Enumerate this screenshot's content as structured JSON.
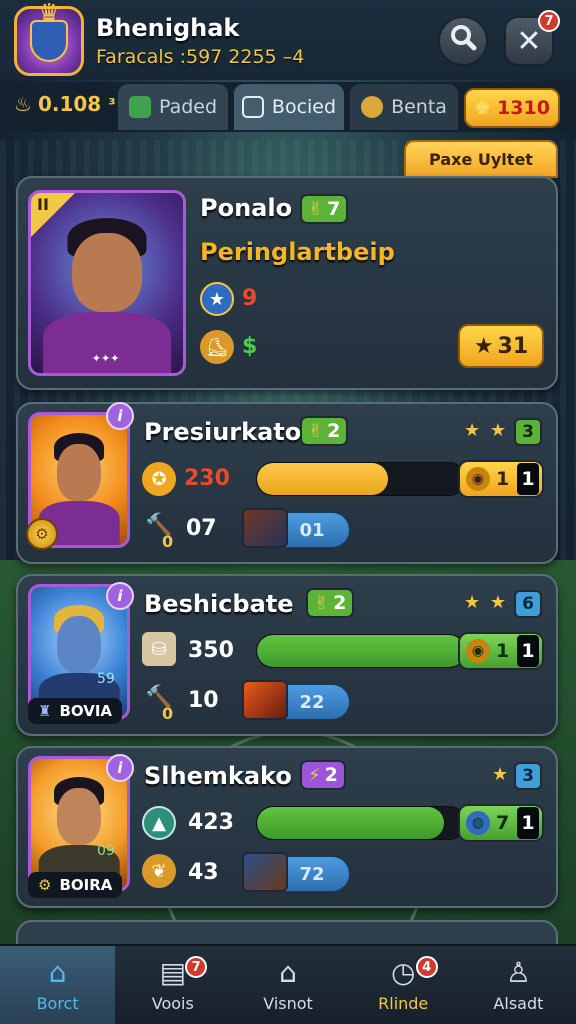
{
  "header": {
    "title": "Bhenighak",
    "subtitle": "Faracals :597 2255 –4",
    "notification_count": "7"
  },
  "tabs": {
    "currency": "0.108 ᶟ",
    "items": [
      {
        "label": "Paded"
      },
      {
        "label": "Bocied"
      },
      {
        "label": "Benta"
      }
    ],
    "gold": "1310"
  },
  "featured": {
    "ribbon": "Paxe Uyltet",
    "corner_tag": "II",
    "portrait_mark": "✦✦✦",
    "name": "Ponalo",
    "level": "7",
    "subtitle": "Peringlartbeip",
    "stat1": "9",
    "stat2": "$",
    "stars_button": "31"
  },
  "cards": [
    {
      "name": "Presiurkato",
      "level": "2",
      "rank": "3",
      "stat_top": "230",
      "progress": 0.63,
      "pill_num": "1",
      "pill_dark": "1",
      "stat_bottom": "07",
      "sub_label": "0",
      "skill": "01"
    },
    {
      "name": "Beshicbate",
      "level": "2",
      "rank": "6",
      "stat_top": "350",
      "progress": 1.0,
      "pill_num": "1",
      "pill_dark": "1",
      "stat_bottom": "10",
      "sub_label": "0",
      "skill": "22",
      "plate": "BOVIA",
      "portrait_num": "59"
    },
    {
      "name": "Slhemkako",
      "level": "2",
      "rank": "3",
      "stat_top": "423",
      "progress": 0.9,
      "pill_num": "7",
      "pill_dark": "1",
      "stat_bottom": "43",
      "skill": "72",
      "plate": "BOIRA",
      "portrait_num": "09"
    }
  ],
  "nav": {
    "items": [
      {
        "label": "Borct"
      },
      {
        "label": "Voois",
        "badge": "7"
      },
      {
        "label": "Visnot"
      },
      {
        "label": "Rlinde",
        "badge": "4"
      },
      {
        "label": "Alsadt"
      }
    ]
  }
}
